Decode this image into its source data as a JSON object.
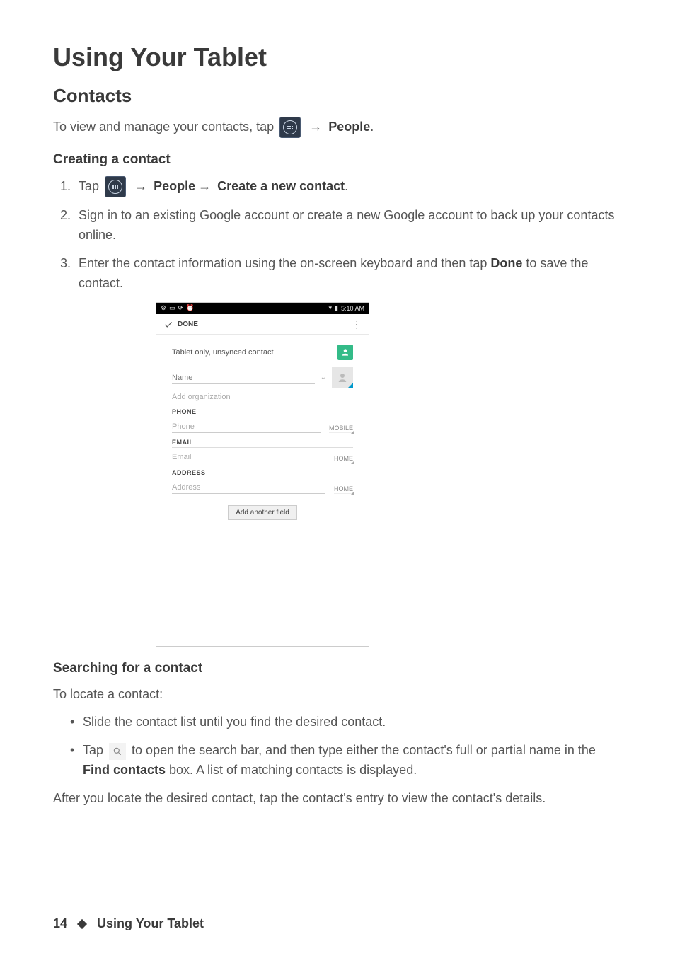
{
  "title": "Using Your Tablet",
  "section": "Contacts",
  "intro_pre": "To view and manage your contacts, tap ",
  "intro_arrow": " → ",
  "intro_post": "People",
  "intro_period": ".",
  "create_heading": "Creating a contact",
  "create_steps": {
    "step1_pre": "Tap ",
    "step1_arrow1": " → ",
    "step1_people": "People",
    "step1_arrow2": "→ ",
    "step1_create": "Create a new contact",
    "step1_period": ".",
    "step2": "Sign in to an existing Google account or create a new Google account to back up your contacts online.",
    "step3_pre": "Enter the contact information using the on-screen keyboard and then tap ",
    "step3_done": "Done",
    "step3_post": " to save the contact."
  },
  "screenshot": {
    "time": "5:10 AM",
    "done_label": "DONE",
    "unsynced": "Tablet only, unsynced contact",
    "name_placeholder": "Name",
    "add_org": "Add organization",
    "phone_section": "PHONE",
    "phone_placeholder": "Phone",
    "phone_type": "MOBILE",
    "email_section": "EMAIL",
    "email_placeholder": "Email",
    "email_type": "HOME",
    "address_section": "ADDRESS",
    "address_placeholder": "Address",
    "address_type": "HOME",
    "add_field_button": "Add another field"
  },
  "search_heading": "Searching for a contact",
  "search_intro": "To locate a contact:",
  "search_bullets": {
    "b1": "Slide the contact list until you find the desired contact.",
    "b2_pre": "Tap ",
    "b2_mid": " to open the search bar, and then type either the contact's full or partial name in the ",
    "b2_find": "Find contacts",
    "b2_post": " box. A list of matching contacts is displayed."
  },
  "search_after": "After you locate the desired contact, tap the contact's entry to view the contact's details.",
  "footer": {
    "page_number": "14",
    "section_name": "Using Your Tablet"
  }
}
